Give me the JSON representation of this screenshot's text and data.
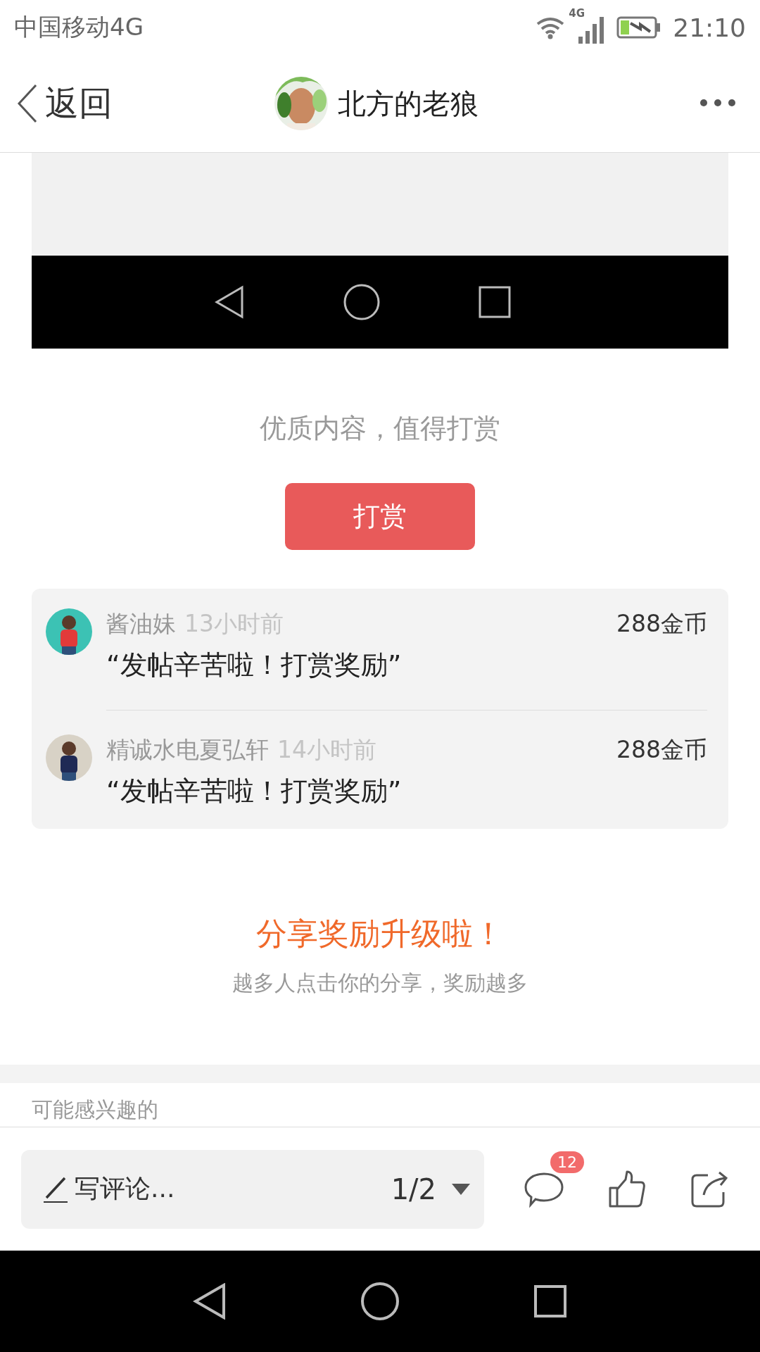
{
  "status_bar": {
    "carrier": "中国移动4G",
    "network": "4G",
    "time": "21:10"
  },
  "header": {
    "back": "返回",
    "title": "北方的老狼"
  },
  "post_image": {
    "kind": "screenshot"
  },
  "reward": {
    "prompt": "优质内容，值得打赏",
    "button": "打赏"
  },
  "rewards": [
    {
      "name": "酱油妹",
      "time": "13小时前",
      "amount": "288金币",
      "message": "“发帖辛苦啦！打赏奖励”"
    },
    {
      "name": "精诚水电夏弘轩",
      "time": "14小时前",
      "amount": "288金币",
      "message": "“发帖辛苦啦！打赏奖励”"
    }
  ],
  "share": {
    "title": "分享奖励升级啦！",
    "subtitle": "越多人点击你的分享，奖励越多"
  },
  "related_heading": "可能感兴趣的",
  "bottom_bar": {
    "placeholder": "写评论...",
    "page": "1/2",
    "comment_count": "12"
  }
}
